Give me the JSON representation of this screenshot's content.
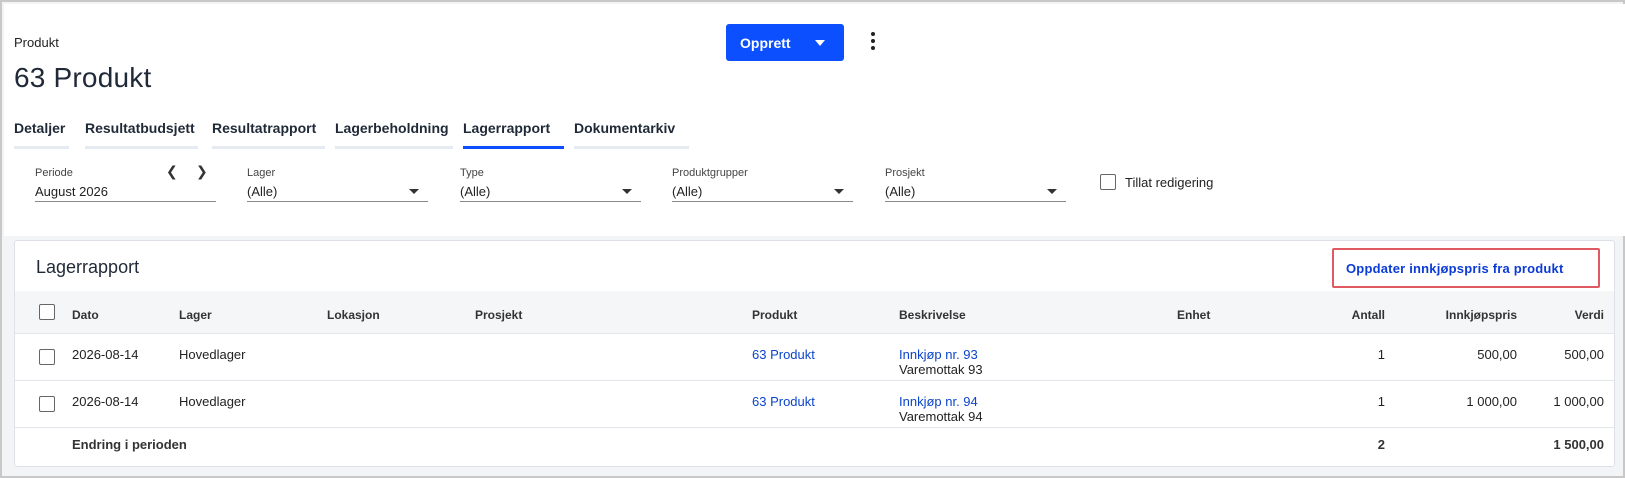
{
  "header": {
    "breadcrumb": "Produkt",
    "title": "63 Produkt",
    "create_label": "Opprett"
  },
  "tabs": [
    {
      "label": "Detaljer",
      "active": false
    },
    {
      "label": "Resultatbudsjett",
      "active": false
    },
    {
      "label": "Resultatrapport",
      "active": false
    },
    {
      "label": "Lagerbeholdning",
      "active": false
    },
    {
      "label": "Lagerrapport",
      "active": true
    },
    {
      "label": "Dokumentarkiv",
      "active": false
    }
  ],
  "filters": {
    "periode": {
      "label": "Periode",
      "value": "August 2026"
    },
    "lager": {
      "label": "Lager",
      "value": "(Alle)"
    },
    "type": {
      "label": "Type",
      "value": "(Alle)"
    },
    "produktgrupper": {
      "label": "Produktgrupper",
      "value": "(Alle)"
    },
    "prosjekt": {
      "label": "Prosjekt",
      "value": "(Alle)"
    },
    "tillat_redigering": {
      "label": "Tillat redigering",
      "checked": false
    }
  },
  "report": {
    "title": "Lagerrapport",
    "update_button": "Oppdater innkjøpspris fra produkt",
    "columns": {
      "dato": "Dato",
      "lager": "Lager",
      "lokasjon": "Lokasjon",
      "prosjekt": "Prosjekt",
      "produkt": "Produkt",
      "beskrivelse": "Beskrivelse",
      "enhet": "Enhet",
      "antall": "Antall",
      "innkjopspris": "Innkjøpspris",
      "verdi": "Verdi"
    },
    "rows": [
      {
        "dato": "2026-08-14",
        "lager": "Hovedlager",
        "lokasjon": "",
        "prosjekt": "",
        "produkt": "63 Produkt",
        "beskrivelse_link": "Innkjøp nr. 93",
        "beskrivelse_sub": "Varemottak 93",
        "enhet": "",
        "antall": "1",
        "innkjopspris": "500,00",
        "verdi": "500,00"
      },
      {
        "dato": "2026-08-14",
        "lager": "Hovedlager",
        "lokasjon": "",
        "prosjekt": "",
        "produkt": "63 Produkt",
        "beskrivelse_link": "Innkjøp nr. 94",
        "beskrivelse_sub": "Varemottak 94",
        "enhet": "",
        "antall": "1",
        "innkjopspris": "1 000,00",
        "verdi": "1 000,00"
      }
    ],
    "total": {
      "label": "Endring i perioden",
      "antall": "2",
      "verdi": "1 500,00"
    }
  }
}
